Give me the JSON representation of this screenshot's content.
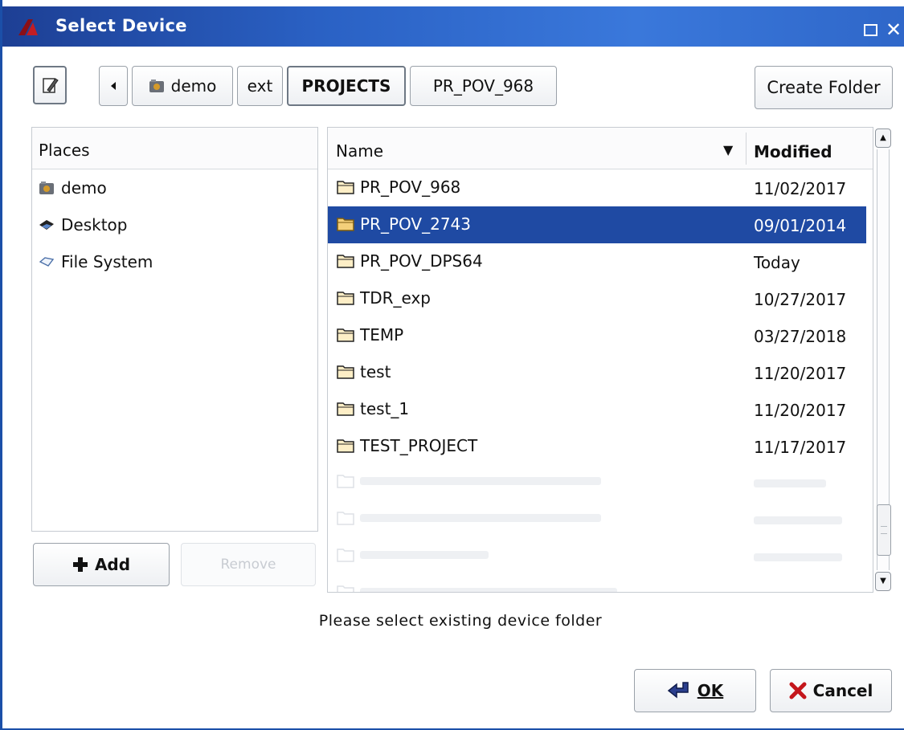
{
  "window": {
    "title": "Select Device",
    "maximize_icon": "maximize-icon",
    "close_label": "✕"
  },
  "toolbar": {
    "edit_icon": "pencil-icon",
    "back_icon": "left-arrow-icon",
    "breadcrumbs": [
      "demo",
      "ext",
      "PROJECTS",
      "PR_POV_968"
    ],
    "active_crumb": "PROJECTS",
    "create_folder_label": "Create Folder"
  },
  "places": {
    "header": "Places",
    "items": [
      {
        "label": "demo",
        "icon": "home-folder-icon"
      },
      {
        "label": "Desktop",
        "icon": "desktop-icon"
      },
      {
        "label": "File System",
        "icon": "drive-icon"
      }
    ],
    "add_label": "Add",
    "remove_label": "Remove"
  },
  "files": {
    "columns": {
      "name": "Name",
      "modified": "Modified"
    },
    "rows": [
      {
        "name": "PR_POV_968",
        "modified": "11/02/2017"
      },
      {
        "name": "PR_POV_2743",
        "modified": "09/01/2014",
        "selected": true
      },
      {
        "name": "PR_POV_DPS64",
        "modified": "Today"
      },
      {
        "name": "TDR_exp",
        "modified": "10/27/2017"
      },
      {
        "name": "TEMP",
        "modified": "03/27/2018"
      },
      {
        "name": "test",
        "modified": "11/20/2017"
      },
      {
        "name": "test_1",
        "modified": "11/20/2017"
      },
      {
        "name": "TEST_PROJECT",
        "modified": "11/17/2017"
      }
    ]
  },
  "status": "Please select existing device folder",
  "buttons": {
    "ok_label": "OK",
    "cancel_label": "Cancel"
  },
  "colors": {
    "title_bar": "#2a61c4",
    "selection": "#1f4aa3",
    "folder": "#f4cf7a"
  }
}
